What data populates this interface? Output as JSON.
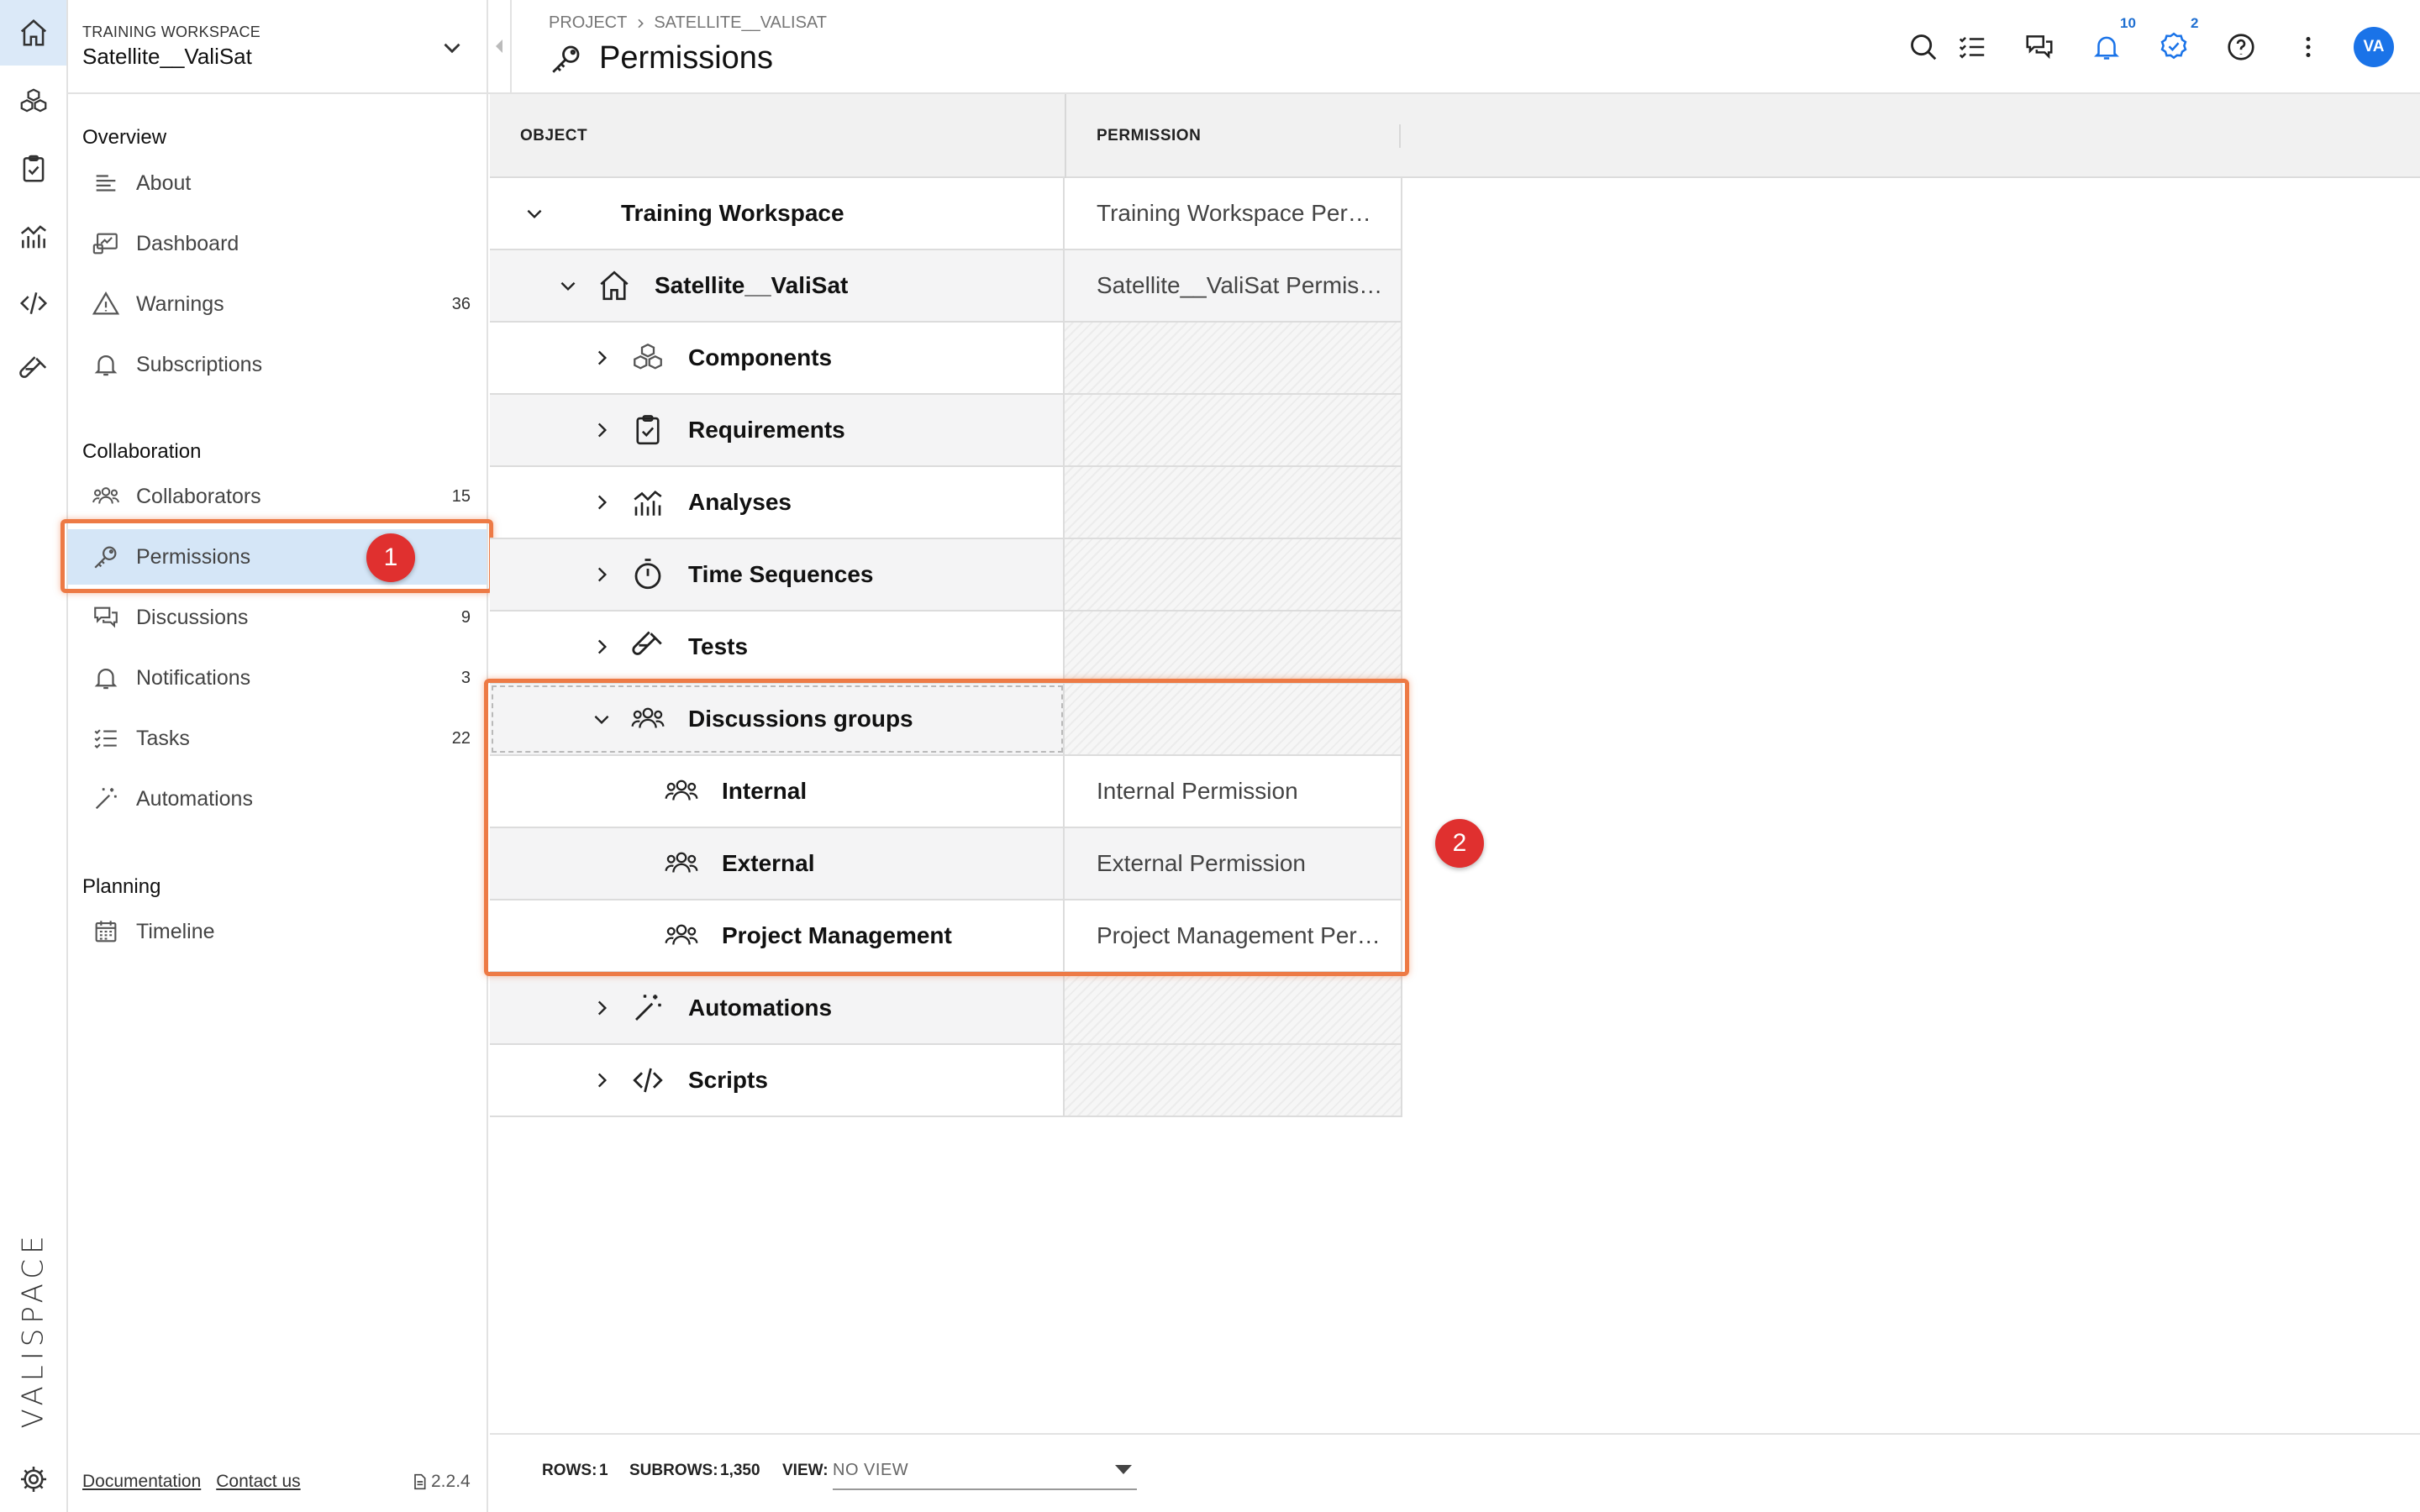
{
  "app": {
    "brand": "VALISPACE",
    "accent": "#1a73e8",
    "annotation_color": "#ed7a45",
    "annotation_badge_color": "#e0302f"
  },
  "workspace": {
    "label": "TRAINING WORKSPACE",
    "name": "Satellite__ValiSat"
  },
  "sidebar": {
    "sections": {
      "overview": "Overview",
      "collaboration": "Collaboration",
      "planning": "Planning"
    },
    "overview_items": [
      {
        "label": "About",
        "icon": "text-lines-icon",
        "count": ""
      },
      {
        "label": "Dashboard",
        "icon": "dashboard-icon",
        "count": ""
      },
      {
        "label": "Warnings",
        "icon": "warning-icon",
        "count": "36"
      },
      {
        "label": "Subscriptions",
        "icon": "bell-icon",
        "count": ""
      }
    ],
    "collaboration_items": [
      {
        "label": "Collaborators",
        "icon": "users-icon",
        "count": "15"
      },
      {
        "label": "Permissions",
        "icon": "key-icon",
        "count": ""
      },
      {
        "label": "Discussions",
        "icon": "chat-icon",
        "count": "9"
      },
      {
        "label": "Notifications",
        "icon": "bell-icon",
        "count": "3"
      },
      {
        "label": "Tasks",
        "icon": "checklist-icon",
        "count": "22"
      },
      {
        "label": "Automations",
        "icon": "magic-wand-icon",
        "count": ""
      }
    ],
    "planning_items": [
      {
        "label": "Timeline",
        "icon": "calendar-icon",
        "count": ""
      }
    ],
    "footer": {
      "documentation": "Documentation",
      "contact": "Contact us",
      "version": "2.2.4"
    }
  },
  "header": {
    "breadcrumb": [
      "PROJECT",
      "SATELLITE__VALISAT"
    ],
    "title": "Permissions",
    "notifications_count": "10",
    "tasks_count": "2",
    "avatar_initials": "VA"
  },
  "table": {
    "columns": [
      "OBJECT",
      "PERMISSION"
    ],
    "rows": [
      {
        "object": "Training Workspace",
        "permission": "Training Workspace Per…",
        "caret": "down",
        "icon": "",
        "depth": 0
      },
      {
        "object": "Satellite__ValiSat",
        "permission": "Satellite__ValiSat Permis…",
        "caret": "down",
        "icon": "home-icon",
        "depth": 1
      },
      {
        "object": "Components",
        "permission": "",
        "caret": "right",
        "icon": "cubes-icon",
        "depth": 2
      },
      {
        "object": "Requirements",
        "permission": "",
        "caret": "right",
        "icon": "clipboard-check-icon",
        "depth": 2
      },
      {
        "object": "Analyses",
        "permission": "",
        "caret": "right",
        "icon": "analytics-icon",
        "depth": 2
      },
      {
        "object": "Time Sequences",
        "permission": "",
        "caret": "right",
        "icon": "stopwatch-icon",
        "depth": 2
      },
      {
        "object": "Tests",
        "permission": "",
        "caret": "right",
        "icon": "test-tube-icon",
        "depth": 2
      },
      {
        "object": "Discussions groups",
        "permission": "",
        "caret": "down",
        "icon": "users-icon",
        "depth": 2
      },
      {
        "object": "Internal",
        "permission": "Internal Permission",
        "caret": "",
        "icon": "users-icon",
        "depth": 3
      },
      {
        "object": "External",
        "permission": "External Permission",
        "caret": "",
        "icon": "users-icon",
        "depth": 3
      },
      {
        "object": "Project Management",
        "permission": "Project Management Per…",
        "caret": "",
        "icon": "users-icon",
        "depth": 3
      },
      {
        "object": "Automations",
        "permission": "",
        "caret": "right",
        "icon": "magic-wand-icon",
        "depth": 2
      },
      {
        "object": "Scripts",
        "permission": "",
        "caret": "right",
        "icon": "code-icon",
        "depth": 2
      }
    ]
  },
  "footer_bar": {
    "rows_label": "ROWS:",
    "rows_value": "1",
    "subrows_label": "SUBROWS:",
    "subrows_value": "1,350",
    "view_label": "VIEW:",
    "view_value": "NO VIEW"
  },
  "annotations": [
    "1",
    "2"
  ]
}
